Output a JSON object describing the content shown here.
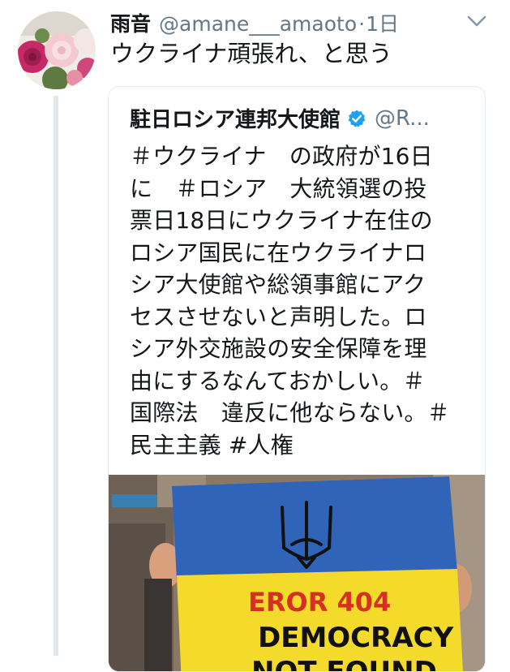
{
  "tweet": {
    "display_name": "雨音",
    "handle": "@amane___amaoto",
    "separator": "·",
    "timestamp": "1日",
    "text": "ウクライナ頑張れ、と思う",
    "avatar_icon": "peony-flowers-avatar",
    "menu_icon": "chevron-down-icon"
  },
  "quoted_tweet": {
    "display_name": "駐日ロシア連邦大使館",
    "verified_icon": "verified-badge-icon",
    "handle": "@R...",
    "text_lines": [
      "＃ウクライナ　の政府が16日",
      "に　＃ロシア　大統領選の投",
      "票日18日にウクライナ在住の",
      "ロシア国民に在ウクライナロ",
      "シア大使館や総領事館にアク",
      "セスさせないと声明した。ロ",
      "シア外交施設の安全保障を理",
      "由にするなんておかしい。＃",
      "国際法　違反に他ならない。＃",
      "民主主義 #人権"
    ],
    "media": {
      "sign_line_1": "EROR 404",
      "sign_line_2": "DEMOCRACY",
      "sign_line_3": "NOT FOUND"
    }
  },
  "colors": {
    "secondary_text": "#657786",
    "verified_blue": "#1da1f2",
    "thread_line": "#e1e8ed",
    "flag_blue": "#2f64b8",
    "flag_yellow": "#f4da2a",
    "sign_red": "#d63022"
  }
}
